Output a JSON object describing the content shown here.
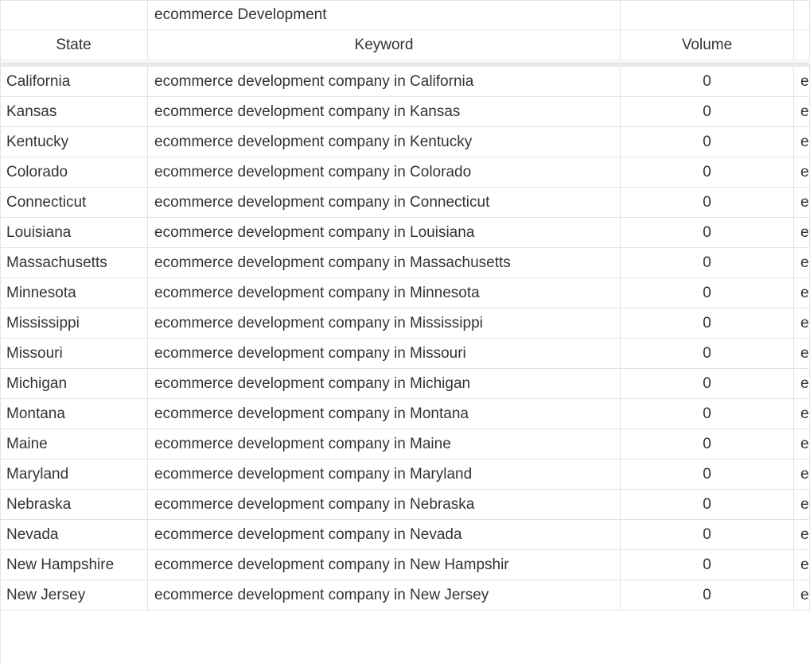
{
  "sheet": {
    "title_cell": "ecommerce Development",
    "columns": {
      "state": "State",
      "keyword": "Keyword",
      "volume": "Volume"
    },
    "trailing_col_glyph": "e",
    "rows": [
      {
        "state": "California",
        "keyword": "ecommerce development company in California",
        "volume": "0"
      },
      {
        "state": "Kansas",
        "keyword": "ecommerce development company in Kansas",
        "volume": "0"
      },
      {
        "state": "Kentucky",
        "keyword": "ecommerce development company in Kentucky",
        "volume": "0"
      },
      {
        "state": "Colorado",
        "keyword": "ecommerce development company in Colorado",
        "volume": "0"
      },
      {
        "state": "Connecticut",
        "keyword": "ecommerce development company in Connecticut",
        "volume": "0"
      },
      {
        "state": "Louisiana",
        "keyword": "ecommerce development company in Louisiana",
        "volume": "0"
      },
      {
        "state": "Massachusetts",
        "keyword": "ecommerce development company in Massachusetts",
        "volume": "0"
      },
      {
        "state": "Minnesota",
        "keyword": "ecommerce development company in Minnesota",
        "volume": "0"
      },
      {
        "state": "Mississippi",
        "keyword": "ecommerce development company in Mississippi",
        "volume": "0"
      },
      {
        "state": "Missouri",
        "keyword": "ecommerce development company in Missouri",
        "volume": "0"
      },
      {
        "state": "Michigan",
        "keyword": "ecommerce development company in Michigan",
        "volume": "0"
      },
      {
        "state": "Montana",
        "keyword": "ecommerce development company in Montana",
        "volume": "0"
      },
      {
        "state": "Maine",
        "keyword": "ecommerce development company in Maine",
        "volume": "0"
      },
      {
        "state": "Maryland",
        "keyword": "ecommerce development company in Maryland",
        "volume": "0"
      },
      {
        "state": "Nebraska",
        "keyword": "ecommerce development company in Nebraska",
        "volume": "0"
      },
      {
        "state": "Nevada",
        "keyword": "ecommerce development company in Nevada",
        "volume": "0"
      },
      {
        "state": "New Hampshire",
        "keyword": "ecommerce development company in New Hampshir",
        "volume": "0"
      },
      {
        "state": "New Jersey",
        "keyword": "ecommerce development company in New Jersey",
        "volume": "0"
      }
    ]
  }
}
